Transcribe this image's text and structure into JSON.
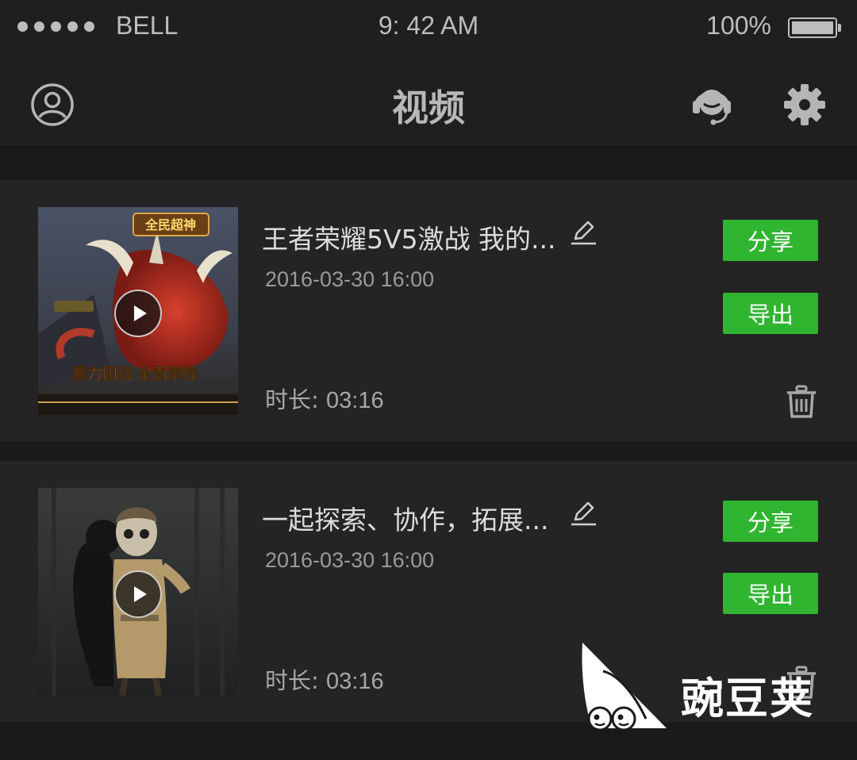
{
  "status_bar": {
    "carrier": "BELL",
    "time": "9: 42 AM",
    "battery": "100%"
  },
  "header": {
    "title": "视频",
    "left_icon": "user-icon",
    "right_icons": [
      "customer-service-headset-icon",
      "gear-icon"
    ]
  },
  "videos": [
    {
      "title": "王者荣耀5V5激战 我的...",
      "date": "2016-03-30  16:00",
      "duration_label": "时长:",
      "duration": "03:16",
      "share_label": "分享",
      "export_label": "导出"
    },
    {
      "title": "一起探索、协作，拓展...",
      "date": "2016-03-30  16:00",
      "duration_label": "时长:",
      "duration": "03:16",
      "share_label": "分享",
      "export_label": "导出"
    }
  ],
  "watermark": "豌豆荚",
  "colors": {
    "accent_green": "#2fb52f",
    "background": "#1a1a1a",
    "card": "#242424"
  }
}
